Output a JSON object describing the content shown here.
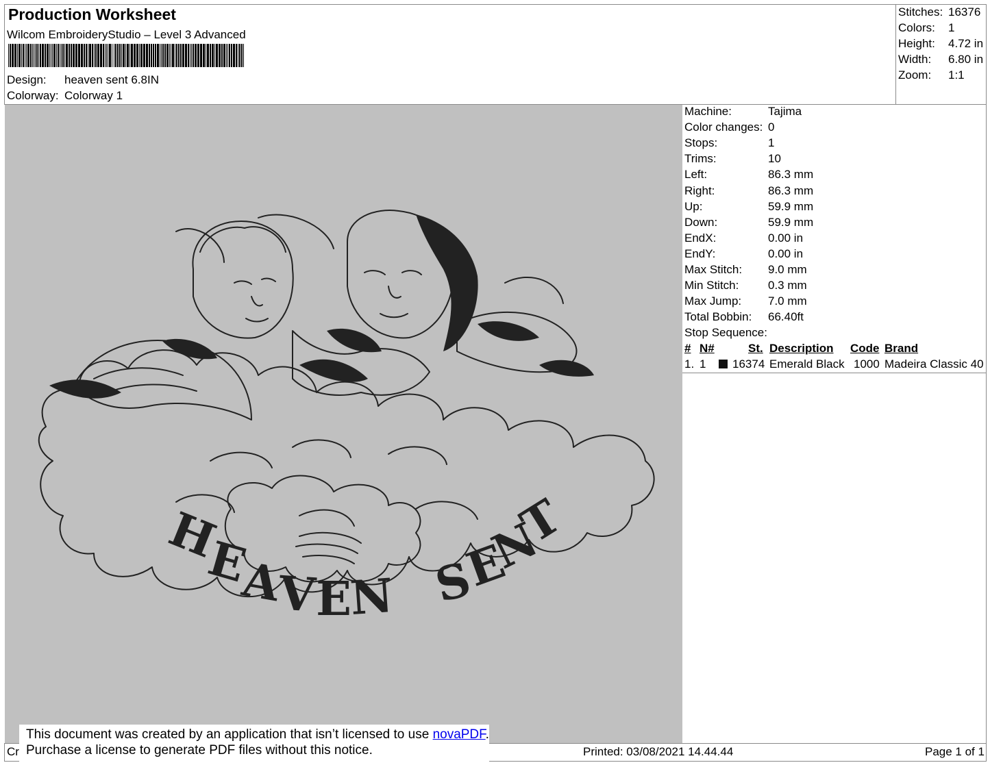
{
  "header": {
    "title": "Production Worksheet",
    "software": "Wilcom EmbroideryStudio – Level 3 Advanced",
    "design_label": "Design:",
    "design_value": "heaven sent 6.8IN",
    "colorway_label": "Colorway:",
    "colorway_value": "Colorway 1"
  },
  "summary": [
    {
      "label": "Stitches:",
      "value": "16376"
    },
    {
      "label": "Colors:",
      "value": "1"
    },
    {
      "label": "Height:",
      "value": "4.72 in"
    },
    {
      "label": "Width:",
      "value": "6.80 in"
    },
    {
      "label": "Zoom:",
      "value": "1:1"
    }
  ],
  "machine_info": [
    {
      "label": "Machine:",
      "value": "Tajima"
    },
    {
      "label": "Color changes:",
      "value": "0"
    },
    {
      "label": "Stops:",
      "value": "1"
    },
    {
      "label": "Trims:",
      "value": "10"
    },
    {
      "label": "Left:",
      "value": "86.3 mm"
    },
    {
      "label": "Right:",
      "value": "86.3 mm"
    },
    {
      "label": "Up:",
      "value": "59.9 mm"
    },
    {
      "label": "Down:",
      "value": "59.9 mm"
    },
    {
      "label": "EndX:",
      "value": "0.00 in"
    },
    {
      "label": "EndY:",
      "value": "0.00 in"
    },
    {
      "label": "Max Stitch:",
      "value": "9.0 mm"
    },
    {
      "label": "Min Stitch:",
      "value": "0.3 mm"
    },
    {
      "label": "Max Jump:",
      "value": "7.0 mm"
    },
    {
      "label": "Total Bobbin:",
      "value": "66.40ft"
    }
  ],
  "stop_sequence": {
    "title": "Stop Sequence:",
    "headers": {
      "num": "#",
      "n": "N#",
      "st": "St.",
      "description": "Description",
      "code": "Code",
      "brand": "Brand"
    },
    "rows": [
      {
        "num": "1.",
        "n": "1",
        "swatch_color": "#111111",
        "st": "16374",
        "description": "Emerald Black",
        "code": "1000",
        "brand": "Madeira Classic 40"
      }
    ]
  },
  "design_preview": {
    "text": "HEAVEN SENT",
    "background": "#c0c0c0",
    "thread_color": "#222222"
  },
  "notice": {
    "line1_prefix": "This document was created by an application that isn’t licensed to use ",
    "link": "novaPDF",
    "line1_suffix": ".",
    "line2": "Purchase a license to generate PDF files without this notice."
  },
  "footer": {
    "left_fragment": "Cr",
    "printed": "Printed: 03/08/2021 14.44.44",
    "page": "Page 1 of 1"
  }
}
